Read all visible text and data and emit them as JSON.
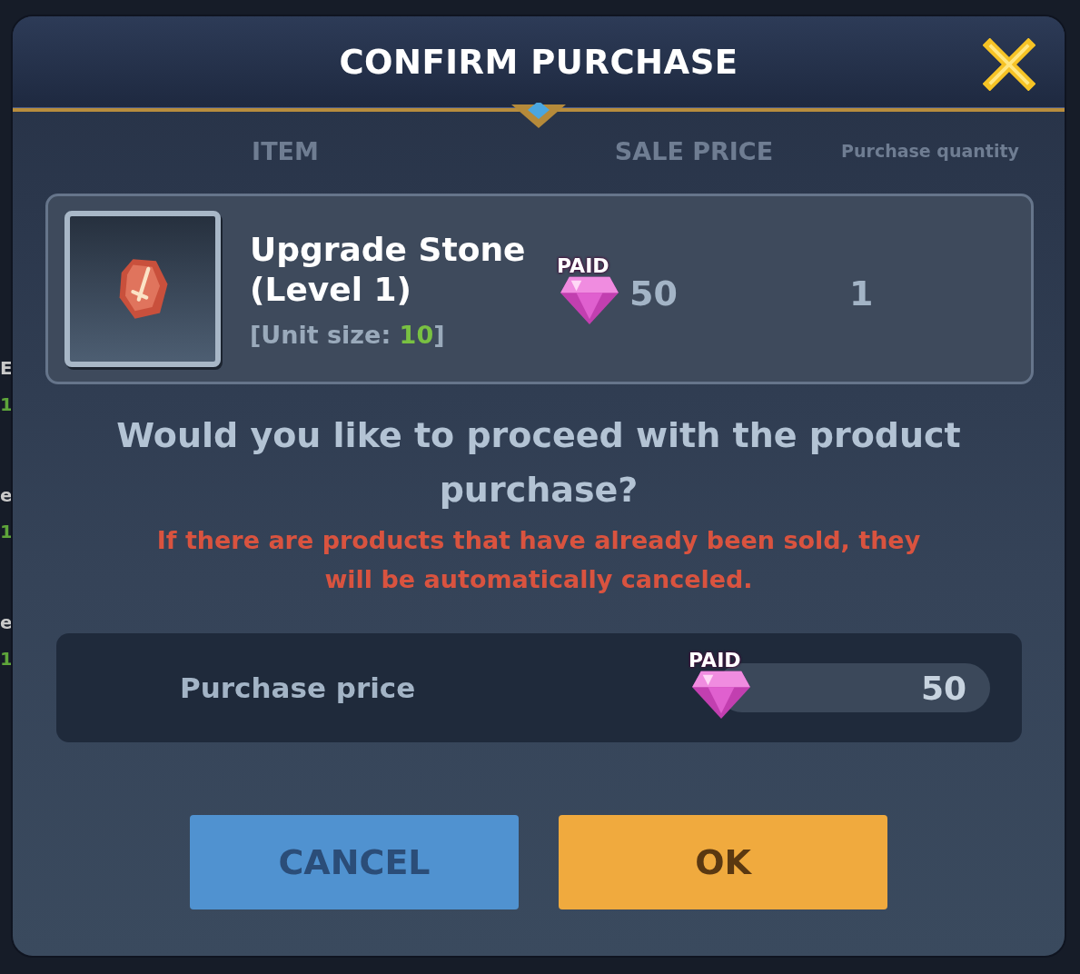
{
  "background_fragments": [
    "E",
    "1",
    "e",
    "1",
    "e",
    "1"
  ],
  "dialog": {
    "title": "CONFIRM PURCHASE",
    "columns": [
      "ITEM",
      "SALE PRICE",
      "Purchase quantity"
    ],
    "item": {
      "name": "Upgrade Stone (Level 1)",
      "unit_size": {
        "prefix": "[Unit size: ",
        "value": "10",
        "suffix": "]"
      },
      "price_badge": "PAID",
      "price": "50",
      "quantity": "1"
    },
    "question": "Would you like to proceed with the product purchase?",
    "warning": "If there are products that have already been sold, they will be automatically canceled.",
    "total": {
      "label": "Purchase price",
      "badge": "PAID",
      "value": "50"
    },
    "buttons": [
      {
        "kind": "cancel",
        "label": "CANCEL"
      },
      {
        "kind": "ok",
        "label": "OK"
      }
    ]
  }
}
